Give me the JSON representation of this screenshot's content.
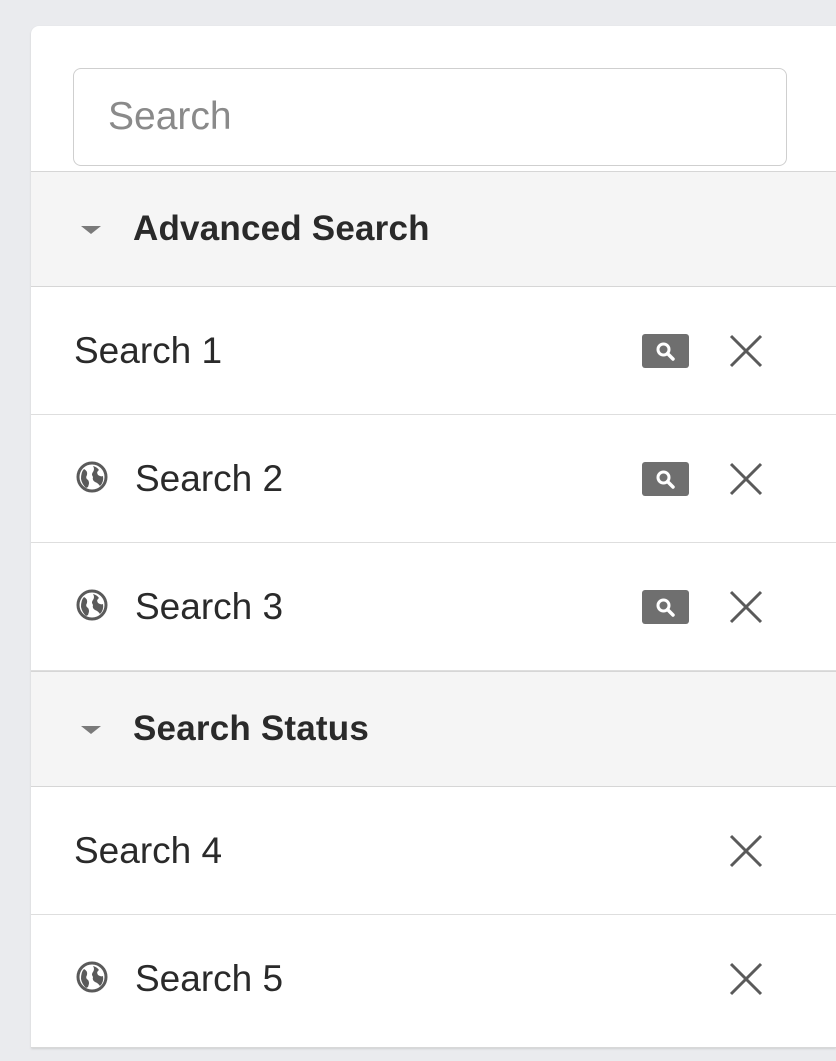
{
  "search": {
    "placeholder": "Search",
    "value": ""
  },
  "sections": [
    {
      "title": "Advanced Search",
      "icon": "caret-down-icon",
      "items": [
        {
          "label": "Search 1",
          "globe": false,
          "has_search_button": true
        },
        {
          "label": "Search 2",
          "globe": true,
          "has_search_button": true
        },
        {
          "label": "Search 3",
          "globe": true,
          "has_search_button": true
        }
      ]
    },
    {
      "title": "Search Status",
      "icon": "caret-down-icon",
      "items": [
        {
          "label": "Search 4",
          "globe": false,
          "has_search_button": false
        },
        {
          "label": "Search 5",
          "globe": true,
          "has_search_button": false
        }
      ]
    }
  ],
  "colors": {
    "page_background": "#eaebee",
    "header_background": "#f5f5f5",
    "icon_gray": "#6f6f6f",
    "text": "#2a2a2a"
  }
}
